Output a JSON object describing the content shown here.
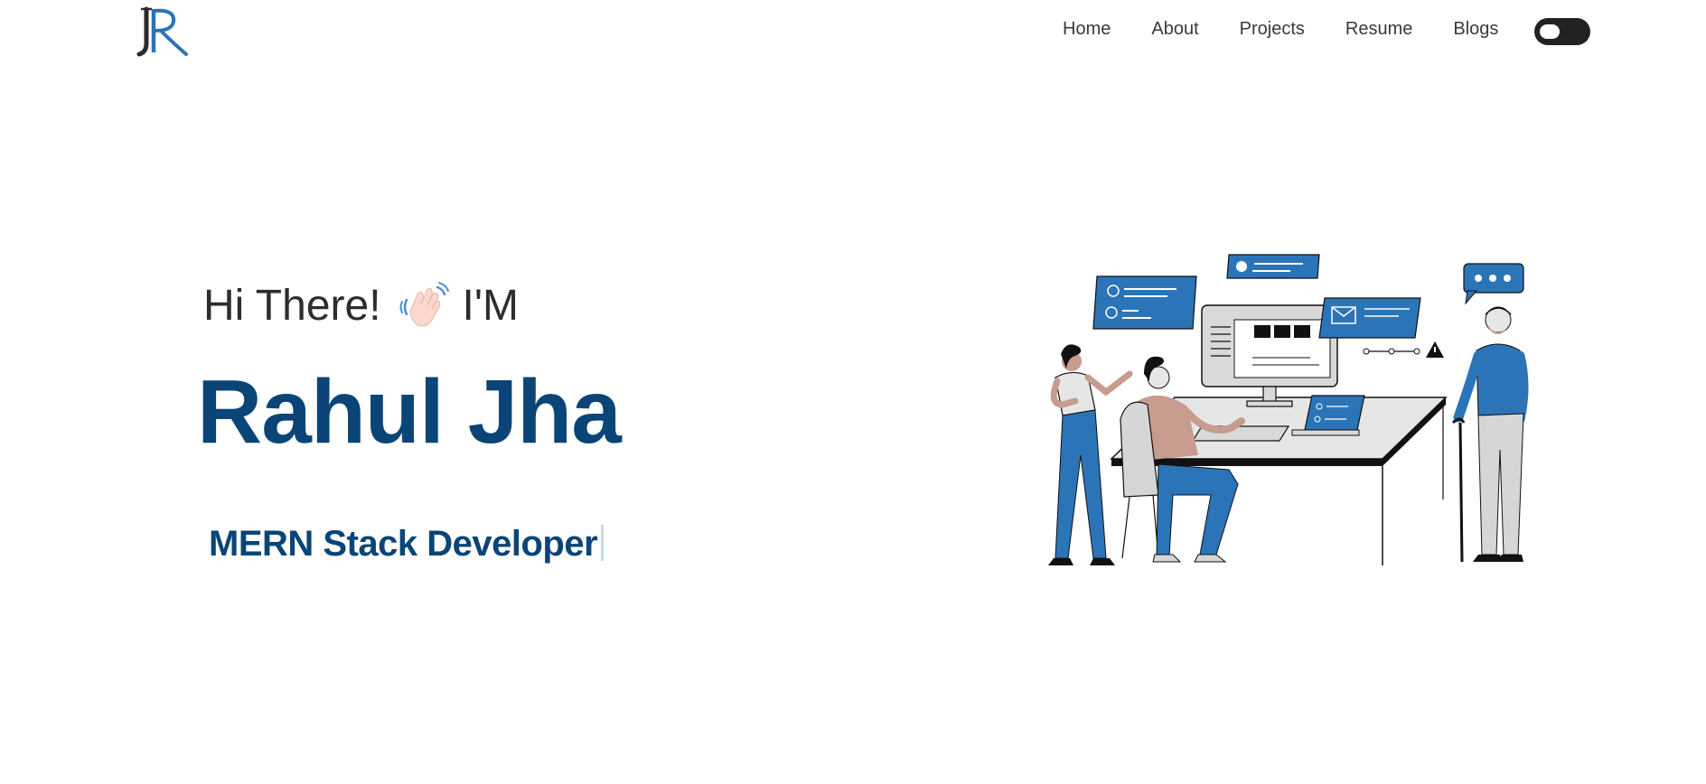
{
  "nav": {
    "logo_text": "JR",
    "links": [
      {
        "label": "Home"
      },
      {
        "label": "About"
      },
      {
        "label": "Projects"
      },
      {
        "label": "Resume"
      },
      {
        "label": "Blogs"
      }
    ],
    "theme_toggle_icon": "toggle-switch-icon"
  },
  "hero": {
    "greeting_prefix": "Hi There!",
    "greeting_suffix": "I'M",
    "wave_icon": "waving-hand-icon",
    "name": "Rahul Jha",
    "role": "MERN Stack Developer"
  },
  "illustration": {
    "icon": "developers-at-computer-illustration",
    "colors": {
      "accent": "#2b74b8",
      "skin": "#c89b8f",
      "gray": "#d6d6d6"
    }
  },
  "colors": {
    "name": "#0b4577",
    "role": "#0b4577",
    "greeting": "#2d2d2d",
    "nav_text": "#3a3a3a",
    "toggle_bg": "#222222"
  }
}
